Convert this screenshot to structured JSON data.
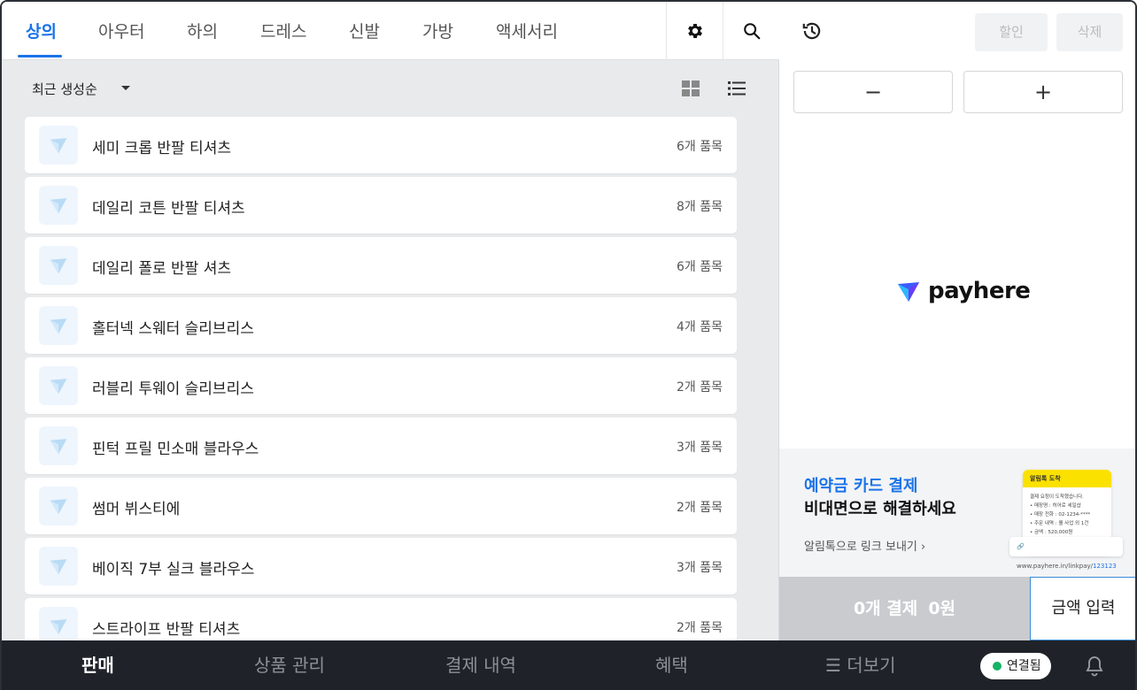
{
  "tabs": [
    {
      "label": "상의",
      "active": true
    },
    {
      "label": "아우터",
      "active": false
    },
    {
      "label": "하의",
      "active": false
    },
    {
      "label": "드레스",
      "active": false
    },
    {
      "label": "신발",
      "active": false
    },
    {
      "label": "가방",
      "active": false
    },
    {
      "label": "액세서리",
      "active": false
    }
  ],
  "tab_icons": [
    "gear-icon",
    "search-icon"
  ],
  "sort": {
    "label": "최근 생성순"
  },
  "view_icons": [
    "grid-view-icon",
    "list-view-icon"
  ],
  "products": [
    {
      "name": "세미 크롭 반팔 티셔츠",
      "count": "6개 품목"
    },
    {
      "name": "데일리 코튼 반팔 티셔츠",
      "count": "8개 품목"
    },
    {
      "name": "데일리 폴로 반팔 셔츠",
      "count": "6개 품목"
    },
    {
      "name": "홀터넥 스웨터 슬리브리스",
      "count": "4개 품목"
    },
    {
      "name": "러블리 투웨이 슬리브리스",
      "count": "2개 품목"
    },
    {
      "name": "핀턱 프릴 민소매 블라우스",
      "count": "3개 품목"
    },
    {
      "name": "썸머 뷔스티에",
      "count": "2개 품목"
    },
    {
      "name": "베이직 7부 실크 블라우스",
      "count": "3개 품목"
    },
    {
      "name": "스트라이프 반팔 티셔츠",
      "count": "2개 품목"
    }
  ],
  "cart": {
    "discount_label": "할인",
    "delete_label": "삭제",
    "minus": "−",
    "plus": "+",
    "logo_text": "payhere"
  },
  "promo": {
    "line1": "예약금 카드 결제",
    "line2": "비대면으로 해결하세요",
    "link": "알림톡으로 링크 보내기 ›",
    "card_title": "알림톡 도착",
    "card_lines": [
      "결제 요청이 도착했습니다.",
      "• 매장명 : 허어로 세일샵",
      "• 매장 전화 : 02-1234-****",
      "• 주문 내역 : 웰 사업 외 1건",
      "• 금액 : 520,000원"
    ],
    "url_prefix": "www.payhere.in/linkpay/",
    "url_code": "123123"
  },
  "payment": {
    "count": "0개 결제",
    "amount": "0원",
    "amount_button": "금액 입력"
  },
  "bottom_nav": [
    {
      "label": "판매",
      "active": true
    },
    {
      "label": "상품 관리",
      "active": false
    },
    {
      "label": "결제 내역",
      "active": false
    },
    {
      "label": "혜택",
      "active": false
    },
    {
      "label": "더보기",
      "active": false
    }
  ],
  "connection": {
    "label": "연결됨",
    "color": "#16b364"
  },
  "colors": {
    "accent": "#1a73e8",
    "nav_bg": "#1f2329",
    "list_bg": "#e9eaec"
  }
}
